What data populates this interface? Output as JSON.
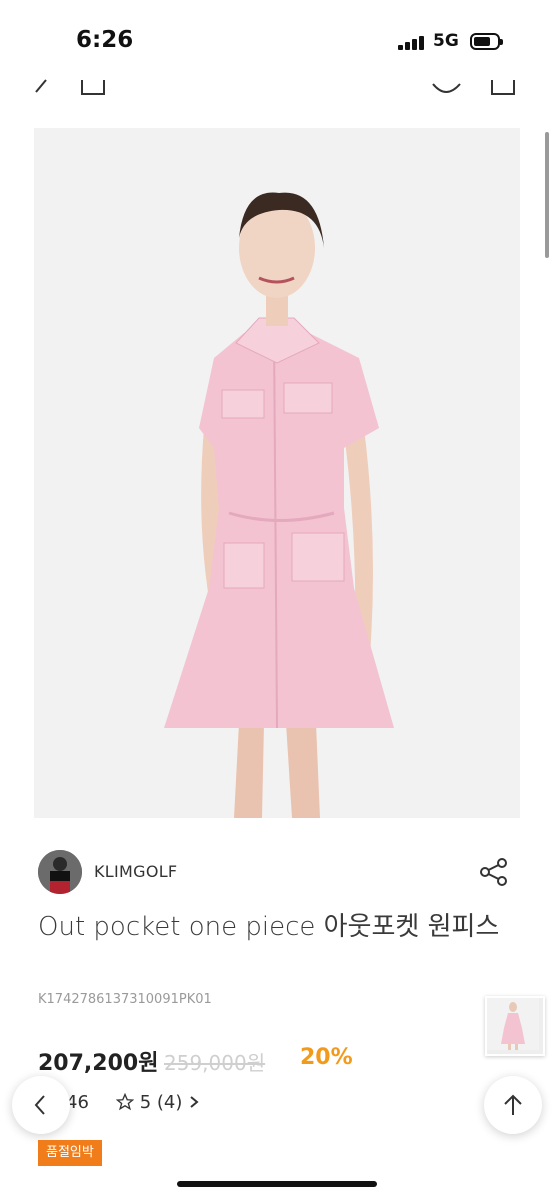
{
  "status": {
    "time": "6:26",
    "network": "5G"
  },
  "brand": {
    "name": "KLIMGOLF"
  },
  "product": {
    "title": "Out pocket one piece 아웃포켓 원피스",
    "sku": "K1742786137310091PK01",
    "price": "207,200원",
    "original_price": "259,000원",
    "discount": "20%",
    "likes": "46",
    "rating_label": "5 (4)",
    "badge": "품절임박"
  },
  "colors": {
    "discount": "#f29a1b",
    "badge_bg": "#f07c1a",
    "dress": "#f3c3d1"
  }
}
